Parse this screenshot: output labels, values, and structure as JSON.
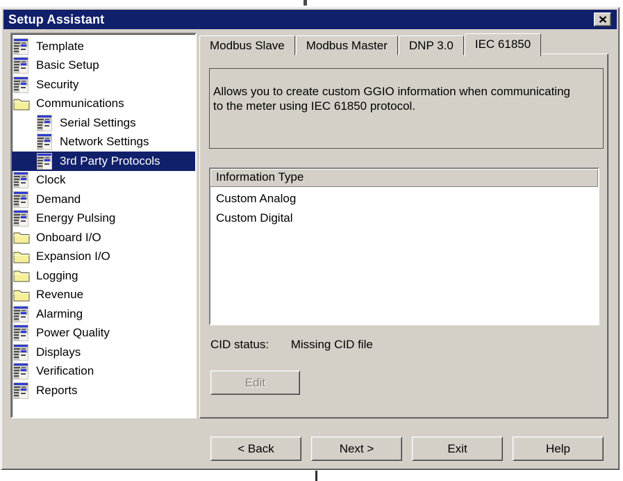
{
  "window": {
    "title": "Setup Assistant"
  },
  "colors": {
    "titlebar": "#11206b",
    "face": "#d4d0c8",
    "selection": "#11206b"
  },
  "sidebar": {
    "items": [
      {
        "label": "Template",
        "icon": "document-icon",
        "indent": 0,
        "selected": false
      },
      {
        "label": "Basic Setup",
        "icon": "document-icon",
        "indent": 0,
        "selected": false
      },
      {
        "label": "Security",
        "icon": "document-icon",
        "indent": 0,
        "selected": false
      },
      {
        "label": "Communications",
        "icon": "folder-icon",
        "indent": 0,
        "selected": false
      },
      {
        "label": "Serial Settings",
        "icon": "document-icon",
        "indent": 1,
        "selected": false
      },
      {
        "label": "Network Settings",
        "icon": "document-icon",
        "indent": 1,
        "selected": false
      },
      {
        "label": "3rd Party Protocols",
        "icon": "document-icon",
        "indent": 1,
        "selected": true
      },
      {
        "label": "Clock",
        "icon": "document-icon",
        "indent": 0,
        "selected": false
      },
      {
        "label": "Demand",
        "icon": "document-icon",
        "indent": 0,
        "selected": false
      },
      {
        "label": "Energy Pulsing",
        "icon": "document-icon",
        "indent": 0,
        "selected": false
      },
      {
        "label": "Onboard I/O",
        "icon": "folder-icon",
        "indent": 0,
        "selected": false
      },
      {
        "label": "Expansion I/O",
        "icon": "folder-icon",
        "indent": 0,
        "selected": false
      },
      {
        "label": "Logging",
        "icon": "folder-icon",
        "indent": 0,
        "selected": false
      },
      {
        "label": "Revenue",
        "icon": "folder-icon",
        "indent": 0,
        "selected": false
      },
      {
        "label": "Alarming",
        "icon": "document-icon",
        "indent": 0,
        "selected": false
      },
      {
        "label": "Power Quality",
        "icon": "document-icon",
        "indent": 0,
        "selected": false
      },
      {
        "label": "Displays",
        "icon": "document-icon",
        "indent": 0,
        "selected": false
      },
      {
        "label": "Verification",
        "icon": "document-icon",
        "indent": 0,
        "selected": false
      },
      {
        "label": "Reports",
        "icon": "document-icon",
        "indent": 0,
        "selected": false
      }
    ]
  },
  "tabs": {
    "items": [
      {
        "label": "Modbus Slave"
      },
      {
        "label": "Modbus Master"
      },
      {
        "label": "DNP 3.0"
      },
      {
        "label": "IEC 61850"
      }
    ],
    "active": "IEC 61850"
  },
  "panel": {
    "description": "Allows you to create custom GGIO information when communicating\nto the meter using IEC 61850 protocol.",
    "info_list": {
      "header": "Information Type",
      "items": [
        "Custom Analog",
        "Custom Digital"
      ]
    },
    "cid": {
      "label": "CID status:",
      "value": "Missing CID file"
    },
    "edit_button": {
      "label": "Edit",
      "enabled": false
    }
  },
  "footer": {
    "buttons": [
      {
        "label": "< Back"
      },
      {
        "label": "Next >"
      },
      {
        "label": "Exit"
      },
      {
        "label": "Help"
      }
    ]
  }
}
